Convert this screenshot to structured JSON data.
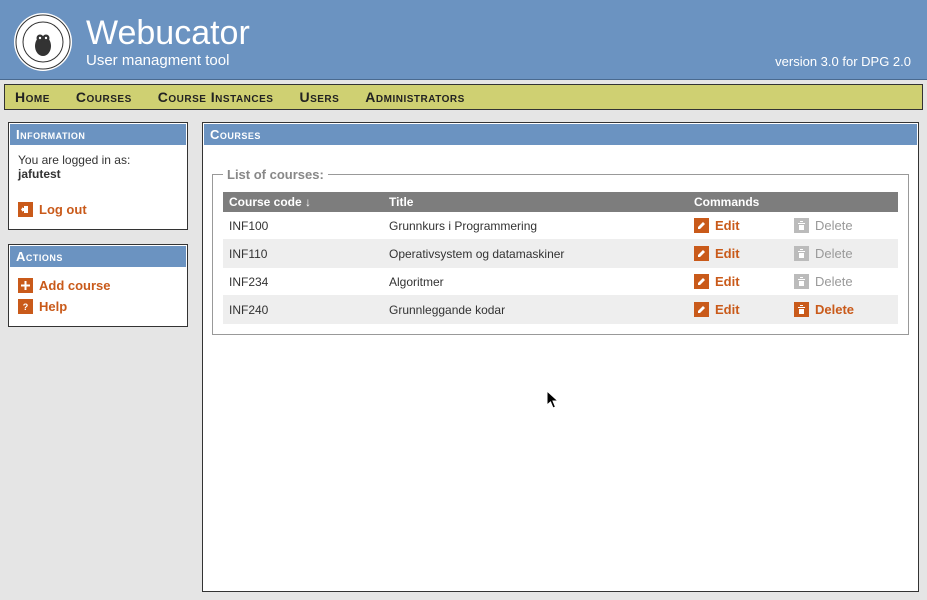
{
  "header": {
    "brand": "Webucator",
    "subtitle": "User managment tool",
    "version": "version 3.0 for DPG 2.0"
  },
  "menu": {
    "home": "Home",
    "courses": "Courses",
    "instances": "Course Instances",
    "users": "Users",
    "admins": "Administrators"
  },
  "info": {
    "title": "Information",
    "logged_in_as": "You are logged in as:",
    "username": "jafutest",
    "logout": "Log out"
  },
  "actions": {
    "title": "Actions",
    "add_course": "Add course",
    "help": "Help"
  },
  "main": {
    "title": "Courses",
    "fieldset_legend": "List of courses:",
    "headers": {
      "code": "Course code ↓",
      "title": "Title",
      "commands": "Commands"
    },
    "rows": [
      {
        "code": "INF100",
        "title": "Grunnkurs i Programmering",
        "edit": "Edit",
        "delete": "Delete",
        "delete_enabled": false
      },
      {
        "code": "INF110",
        "title": "Operativsystem og datamaskiner",
        "edit": "Edit",
        "delete": "Delete",
        "delete_enabled": false
      },
      {
        "code": "INF234",
        "title": "Algoritmer",
        "edit": "Edit",
        "delete": "Delete",
        "delete_enabled": false
      },
      {
        "code": "INF240",
        "title": "Grunnleggande kodar",
        "edit": "Edit",
        "delete": "Delete",
        "delete_enabled": true
      }
    ]
  }
}
